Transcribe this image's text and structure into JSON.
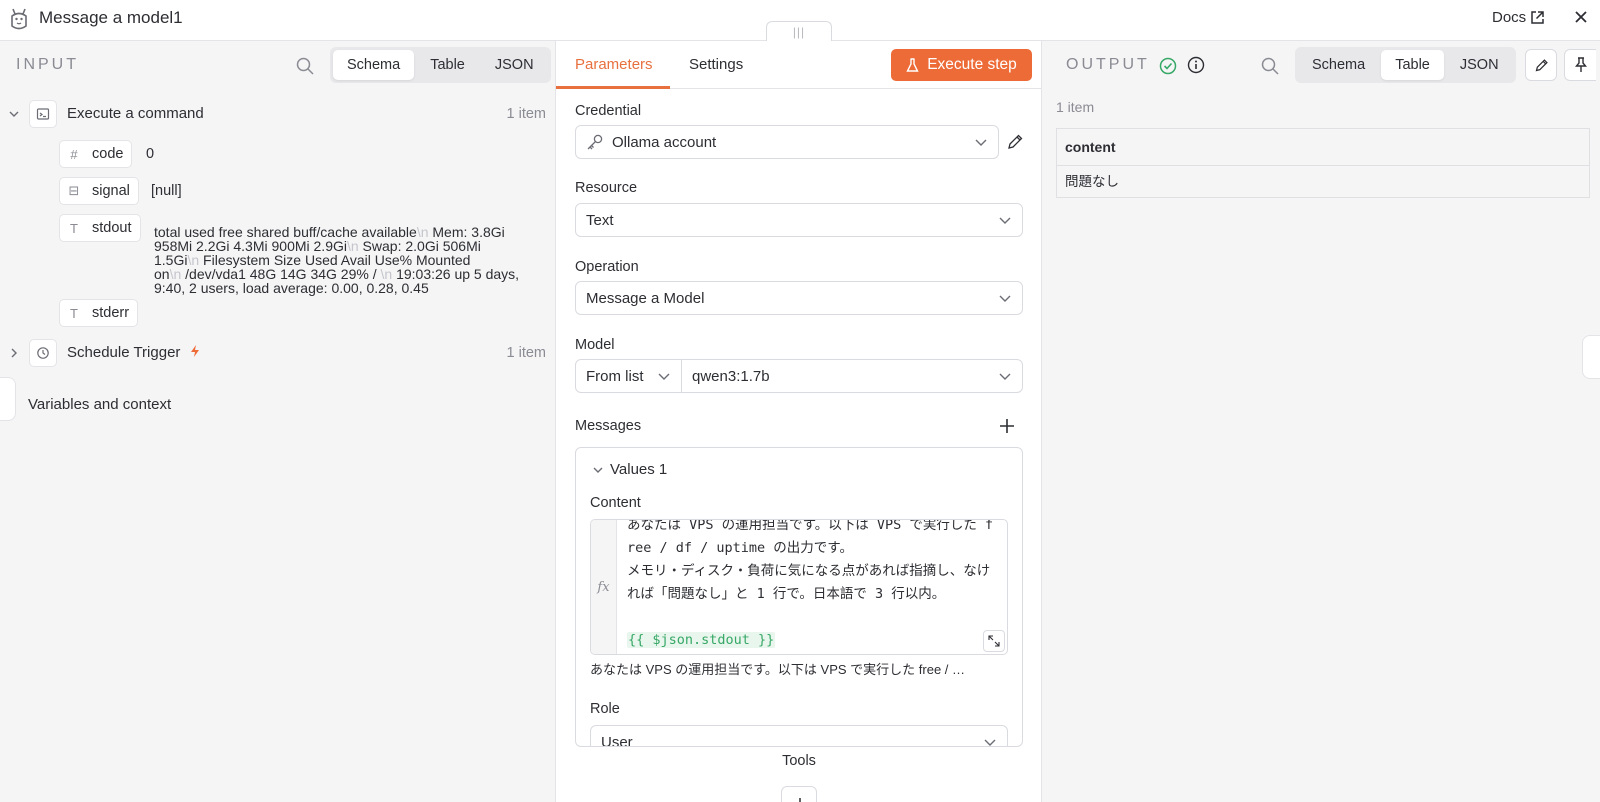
{
  "header": {
    "title": "Message a model1",
    "docs_label": "Docs",
    "drag_handle": "|||"
  },
  "input": {
    "label": "INPUT",
    "view_tabs": [
      "Schema",
      "Table",
      "JSON"
    ],
    "active_tab": "Schema",
    "nodes": [
      {
        "name": "Execute a command",
        "count": "1 item",
        "fields": [
          {
            "type_icon": "#",
            "name": "code",
            "value": "0"
          },
          {
            "type_icon": "⊟",
            "name": "signal",
            "value": "[null]"
          },
          {
            "type_icon": "T",
            "name": "stdout",
            "value_lines": [
              [
                "total used free shared buff/cache available",
                "\\n",
                " Mem: 3.8Gi"
              ],
              [
                "958Mi 2.2Gi 4.3Mi 900Mi 2.9Gi",
                "\\n",
                " Swap: 2.0Gi 506Mi"
              ],
              [
                "1.5Gi",
                "\\n",
                " Filesystem Size Used Avail Use% Mounted"
              ],
              [
                "on",
                "\\n",
                " /dev/vda1 48G 14G 34G 29% / ",
                "\\n",
                " 19:03:26 up 5 days,"
              ],
              [
                "9:40, 2 users, load average: 0.00, 0.28, 0.45"
              ]
            ]
          },
          {
            "type_icon": "T",
            "name": "stderr",
            "value": ""
          }
        ]
      },
      {
        "name": "Schedule Trigger",
        "count": "1 item"
      }
    ],
    "variables_label": "Variables and context"
  },
  "params": {
    "tabs": {
      "parameters": "Parameters",
      "settings": "Settings"
    },
    "execute_label": "Execute step",
    "credential": {
      "label": "Credential",
      "value": "Ollama account"
    },
    "resource": {
      "label": "Resource",
      "value": "Text"
    },
    "operation": {
      "label": "Operation",
      "value": "Message a Model"
    },
    "model": {
      "label": "Model",
      "mode": "From list",
      "value": "qwen3:1.7b"
    },
    "messages": {
      "label": "Messages",
      "values_title": "Values 1",
      "content_label": "Content",
      "content_lines": [
        "あなたは VPS の運用担当です。以下は VPS で実行した f",
        "ree / df / uptime の出力です。",
        "メモリ・ディスク・負荷に気になる点があれば指摘し、なけ",
        "れば「問題なし」と 1 行で。日本語で 3 行以内。",
        ""
      ],
      "content_expr": "{{ $json.stdout }}",
      "preview": "あなたは VPS の運用担当です。以下は VPS で実行した free / …",
      "role_label": "Role",
      "role_value": "User"
    },
    "tools_label": "Tools"
  },
  "output": {
    "label": "OUTPUT",
    "view_tabs": [
      "Schema",
      "Table",
      "JSON"
    ],
    "active_tab": "Table",
    "count": "1 item",
    "table": {
      "columns": [
        "content"
      ],
      "rows": [
        [
          "問題なし"
        ]
      ]
    }
  },
  "colors": {
    "accent": "#e8703f",
    "execute_bg": "#ed6b37",
    "success": "#37a866",
    "text": "#2d2e33",
    "muted": "#8a8b93"
  }
}
